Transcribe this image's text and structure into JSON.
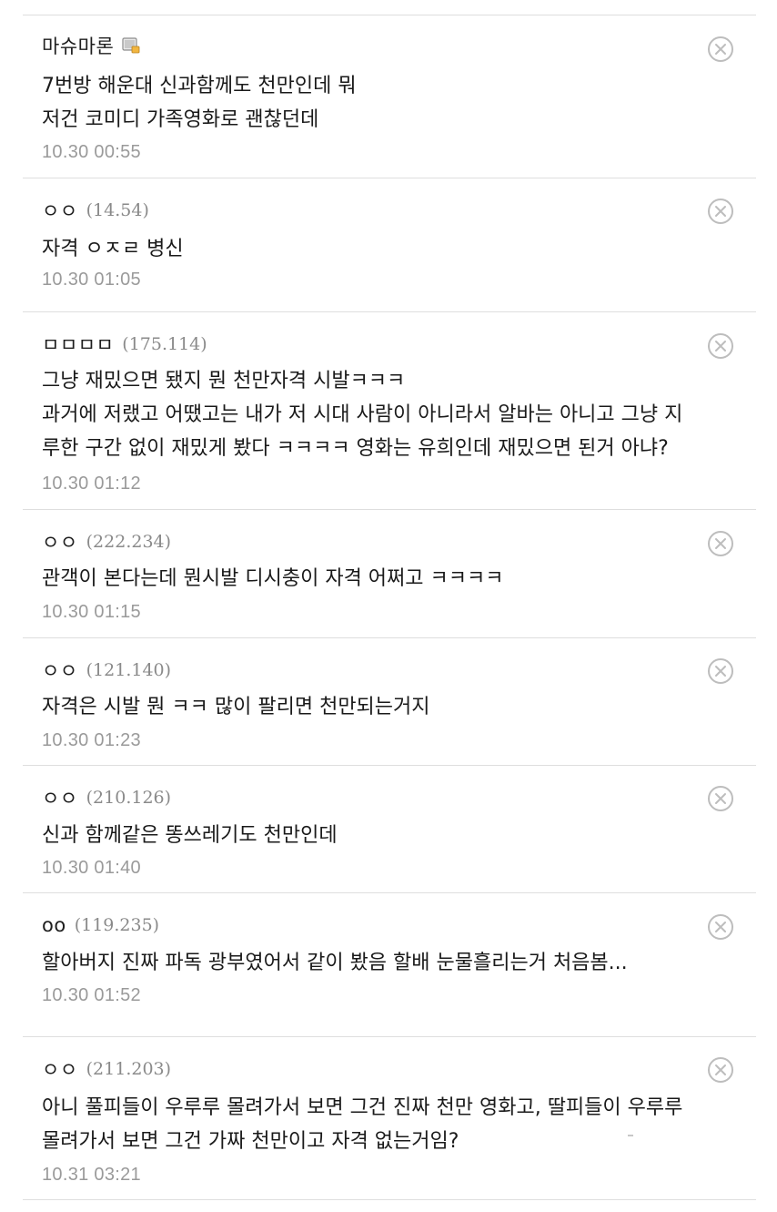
{
  "comments": [
    {
      "nickname": "마슈마론",
      "ip": "",
      "is_member": true,
      "lines": "7번방 해운대 신과함께도 천만인데 뭐\n저건 코미디 가족영화로 괜찮던데",
      "date": "10.30 00:55"
    },
    {
      "nickname": "ㅇㅇ",
      "ip": "(14.54)",
      "is_member": false,
      "lines": "자격 ㅇㅈㄹ 병신",
      "date": "10.30 01:05"
    },
    {
      "nickname": "ㅁㅁㅁㅁ",
      "ip": "(175.114)",
      "is_member": false,
      "lines": "그냥 재밌으면 됐지 뭔 천만자격 시발ㅋㅋㅋ\n과거에 저랬고 어땠고는 내가 저 시대 사람이 아니라서 알바는 아니고 그냥 지\n루한 구간 없이 재밌게 봤다 ㅋㅋㅋㅋ 영화는 유희인데 재밌으면 된거 아냐?",
      "date": "10.30 01:12"
    },
    {
      "nickname": "ㅇㅇ",
      "ip": "(222.234)",
      "is_member": false,
      "lines": "관객이 본다는데 뭔시발 디시충이 자격 어쩌고 ㅋㅋㅋㅋ",
      "date": "10.30 01:15"
    },
    {
      "nickname": "ㅇㅇ",
      "ip": "(121.140)",
      "is_member": false,
      "lines": "자격은 시발 뭔 ㅋㅋ 많이 팔리면 천만되는거지",
      "date": "10.30 01:23"
    },
    {
      "nickname": "ㅇㅇ",
      "ip": "(210.126)",
      "is_member": false,
      "lines": "신과 함께같은 똥쓰레기도 천만인데",
      "date": "10.30 01:40"
    },
    {
      "nickname": "oo",
      "ip": "(119.235)",
      "is_member": false,
      "lines": "할아버지 진짜 파독 광부였어서 같이 봤음 할배 눈물흘리는거 처음봄...",
      "date": "10.30 01:52"
    },
    {
      "nickname": "ㅇㅇ",
      "ip": "(211.203)",
      "is_member": false,
      "lines": "아니 풀피들이 우루루 몰려가서 보면 그건 진짜 천만 영화고, 딸피들이 우루루\n몰려가서 보면 그건 가짜 천만이고 자격 없는거임?",
      "date": "10.31 03:21"
    }
  ],
  "icons": {
    "delete": "circle-x-icon",
    "member": "member-badge-icon"
  },
  "colors": {
    "divider": "#dedede",
    "ip": "#8a8a8a",
    "date": "#9a9a9a",
    "delete_icon": "#bdbdbd"
  }
}
